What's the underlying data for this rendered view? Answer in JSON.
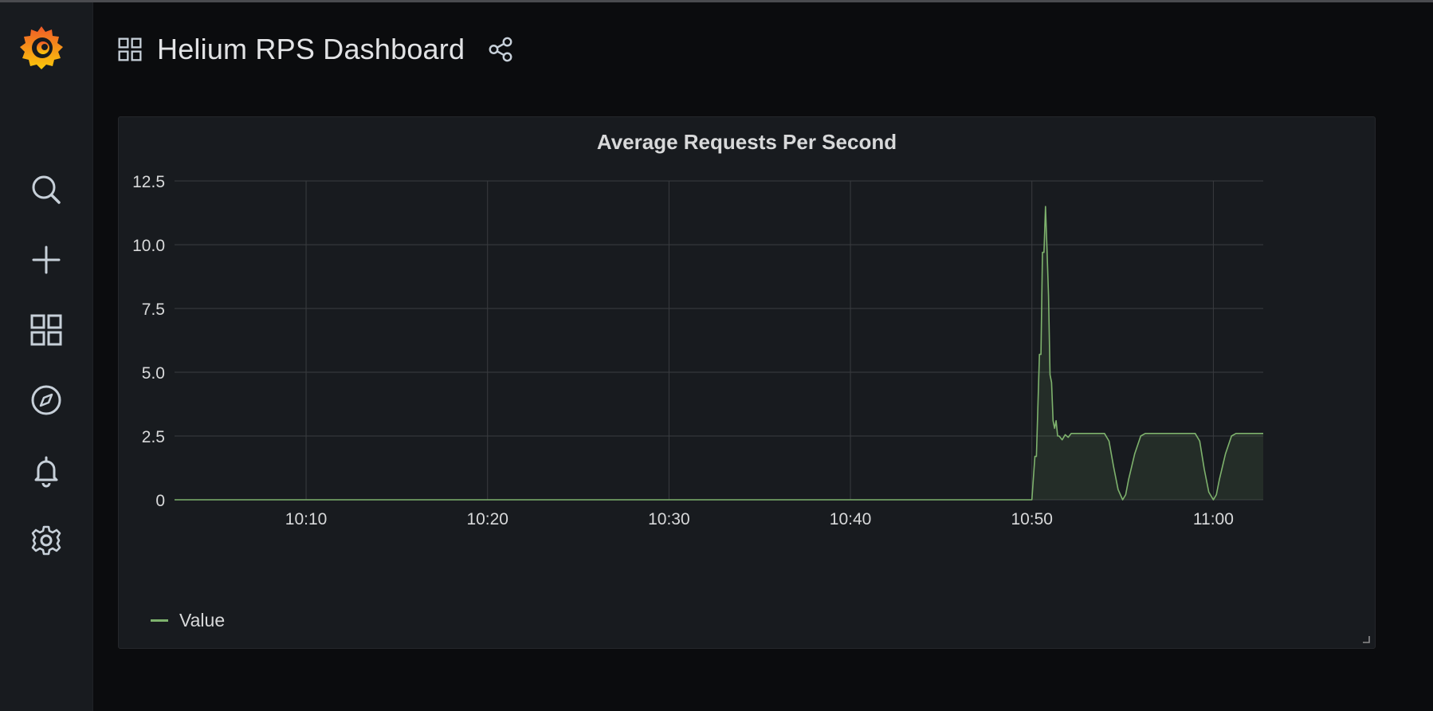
{
  "header": {
    "title": "Helium RPS Dashboard"
  },
  "panel": {
    "title": "Average Requests Per Second"
  },
  "sidebar": {
    "items": [
      {
        "icon": "search-icon"
      },
      {
        "icon": "plus-icon"
      },
      {
        "icon": "dashboards-icon"
      },
      {
        "icon": "compass-icon"
      },
      {
        "icon": "bell-icon"
      },
      {
        "icon": "gear-icon"
      }
    ]
  },
  "colors": {
    "series": "#7eb26d",
    "background": "#0b0c0e",
    "panel": "#181b1f",
    "grid": "#3a3c40"
  },
  "chart_data": {
    "type": "area",
    "title": "Average Requests Per Second",
    "xlabel": "",
    "ylabel": "",
    "x_tick_labels": [
      "10:10",
      "10:20",
      "10:30",
      "10:40",
      "10:50",
      "11:00"
    ],
    "y_tick_labels": [
      "0",
      "2.5",
      "5.0",
      "7.5",
      "10.0",
      "12.5"
    ],
    "xlim": [
      "10:02:45",
      "11:02:45"
    ],
    "ylim": [
      0,
      12.5
    ],
    "grid": true,
    "legend": "bottom-left",
    "series": [
      {
        "name": "Value",
        "color": "#7eb26d",
        "x": [
          "10:02:45",
          "10:50:00",
          "10:50:10",
          "10:50:15",
          "10:50:25",
          "10:50:30",
          "10:50:35",
          "10:50:40",
          "10:50:45",
          "10:50:50",
          "10:50:55",
          "10:51:00",
          "10:51:05",
          "10:51:10",
          "10:51:15",
          "10:51:20",
          "10:51:25",
          "10:51:30",
          "10:51:40",
          "10:51:50",
          "10:52:00",
          "10:52:10",
          "10:52:20",
          "10:52:30",
          "10:52:45",
          "10:53:00",
          "10:53:30",
          "10:54:00",
          "10:54:15",
          "10:54:30",
          "10:54:45",
          "10:55:00",
          "10:55:10",
          "10:55:20",
          "10:55:40",
          "10:56:00",
          "10:56:15",
          "10:56:30",
          "10:57:00",
          "10:58:00",
          "10:59:00",
          "10:59:15",
          "10:59:30",
          "10:59:45",
          "11:00:00",
          "11:00:10",
          "11:00:20",
          "11:00:40",
          "11:01:00",
          "11:01:15",
          "11:02:00",
          "11:02:45"
        ],
        "y": [
          0,
          0,
          1.7,
          1.7,
          5.7,
          5.7,
          9.7,
          9.7,
          11.5,
          9.8,
          8.0,
          4.9,
          4.6,
          3.1,
          2.8,
          3.1,
          2.5,
          2.5,
          2.35,
          2.55,
          2.45,
          2.6,
          2.6,
          2.6,
          2.6,
          2.6,
          2.6,
          2.6,
          2.3,
          1.3,
          0.4,
          0,
          0.2,
          0.8,
          1.8,
          2.5,
          2.6,
          2.6,
          2.6,
          2.6,
          2.6,
          2.3,
          1.2,
          0.3,
          0,
          0.2,
          0.8,
          1.8,
          2.5,
          2.6,
          2.6,
          2.6
        ]
      }
    ]
  }
}
